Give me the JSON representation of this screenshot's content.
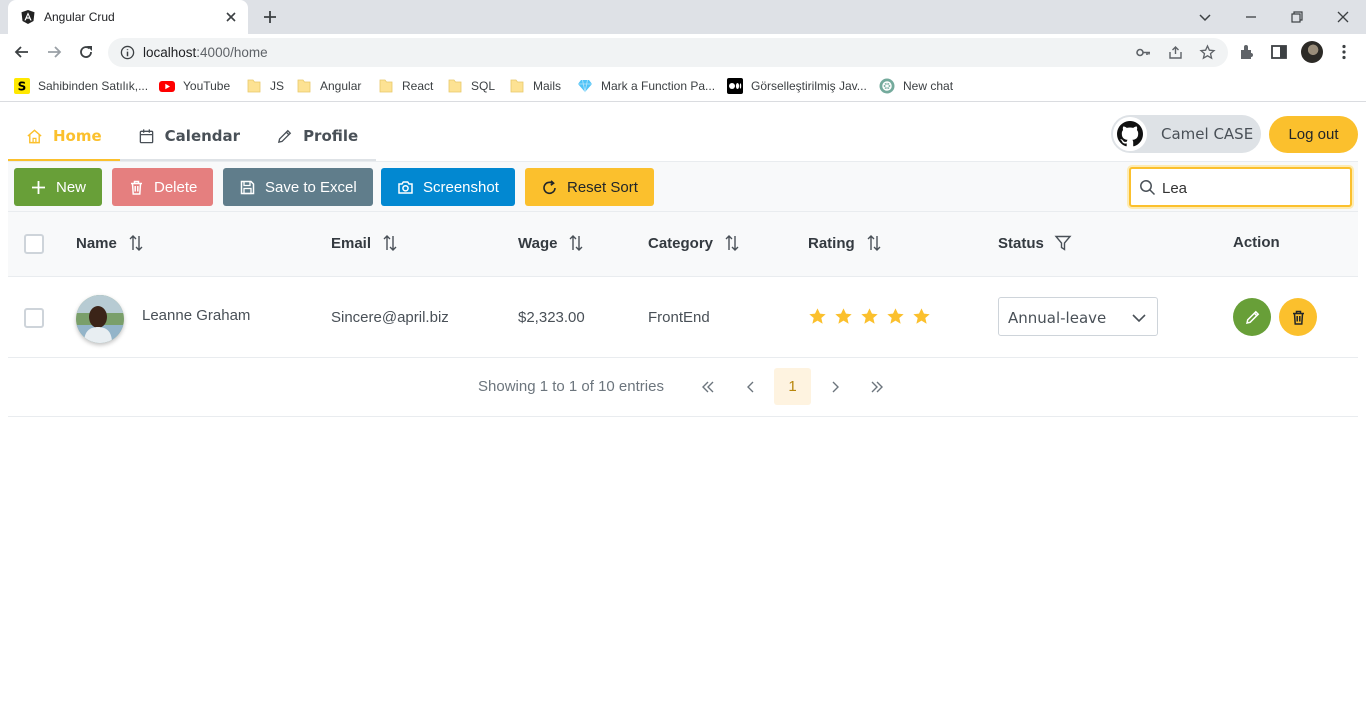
{
  "browser": {
    "tab_title": "Angular Crud",
    "url_host": "localhost",
    "url_rest": ":4000/home",
    "bookmarks": [
      {
        "label": "Sahibinden Satılık,...",
        "icon": "sahibinden-icon"
      },
      {
        "label": "YouTube",
        "icon": "youtube-icon"
      },
      {
        "label": "JS",
        "icon": "folder-icon"
      },
      {
        "label": "Angular",
        "icon": "folder-icon"
      },
      {
        "label": "React",
        "icon": "folder-icon"
      },
      {
        "label": "SQL",
        "icon": "folder-icon"
      },
      {
        "label": "Mails",
        "icon": "folder-icon"
      },
      {
        "label": "Mark a Function Pa...",
        "icon": "diamond-icon"
      },
      {
        "label": "Görselleştirilmiş Jav...",
        "icon": "medium-icon"
      },
      {
        "label": "New chat",
        "icon": "openai-icon"
      }
    ]
  },
  "menu": {
    "items": [
      {
        "label": "Home",
        "icon": "home-icon",
        "active": true
      },
      {
        "label": "Calendar",
        "icon": "calendar-icon",
        "active": false
      },
      {
        "label": "Profile",
        "icon": "pencil-icon",
        "active": false
      }
    ],
    "github_label": "Camel CASE",
    "logout_label": "Log out"
  },
  "toolbar": {
    "new_label": "New",
    "delete_label": "Delete",
    "excel_label": "Save to Excel",
    "screenshot_label": "Screenshot",
    "reset_sort_label": "Reset Sort",
    "search_value": "Lea"
  },
  "table": {
    "columns": {
      "name": "Name",
      "email": "Email",
      "wage": "Wage",
      "category": "Category",
      "rating": "Rating",
      "status": "Status",
      "action": "Action"
    },
    "rows": [
      {
        "name": "Leanne Graham",
        "email": "Sincere@april.biz",
        "wage": "$2,323.00",
        "category": "FrontEnd",
        "rating": 5,
        "status": "Annual-leave"
      }
    ]
  },
  "paginator": {
    "info": "Showing 1 to 1 of 10 entries",
    "current_page": "1"
  },
  "colors": {
    "accent": "#FBC02D",
    "new": "#689F38",
    "delete": "#E57F7F",
    "excel": "#607D8B",
    "screenshot": "#0288D1",
    "edit": "#689F38",
    "remove": "#FBC02D"
  }
}
